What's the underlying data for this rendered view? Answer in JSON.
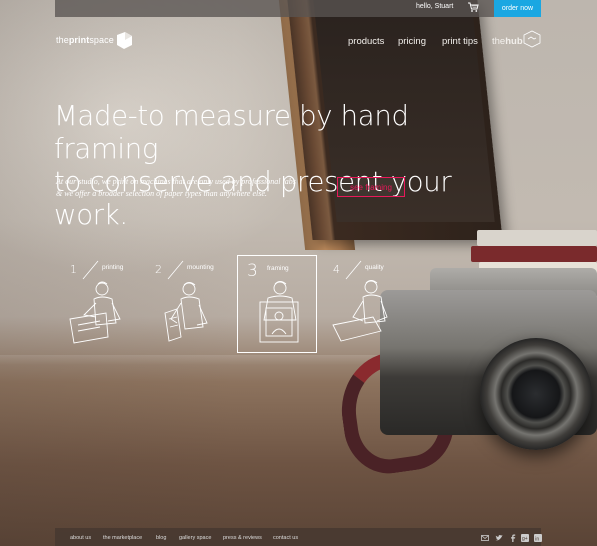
{
  "topbar": {
    "greeting": "hello, Stuart",
    "cart_icon": "shopping-cart-icon",
    "order_button": "order now",
    "order_color": "#1aa7e2"
  },
  "header": {
    "logo_prefix": "the",
    "logo_bold": "print",
    "logo_suffix": "space",
    "nav": [
      {
        "label": "products"
      },
      {
        "label": "pricing"
      },
      {
        "label": "print tips"
      }
    ],
    "hub_prefix": "the",
    "hub_bold": "hub"
  },
  "hero": {
    "headline_line1": "Made-to measure by hand framing",
    "headline_line2": "to conserve and present your work.",
    "sub_line1": "At our studio, we print on machines that are only used by professional labs",
    "sub_line2": "& we offer a broader selection of paper types than anywhere else.",
    "cta": "see framing",
    "cta_color": "#e8195a"
  },
  "steps": [
    {
      "num": "1",
      "label": "printing",
      "active": false
    },
    {
      "num": "2",
      "label": "mounting",
      "active": false
    },
    {
      "num": "3",
      "label": "framing",
      "active": true
    },
    {
      "num": "4",
      "label": "quality",
      "active": false
    }
  ],
  "footer": {
    "links": [
      "about us",
      "the marketplace",
      "blog",
      "gallery space",
      "press & reviews",
      "contact us"
    ],
    "social_icons": [
      "email-icon",
      "twitter-icon",
      "facebook-icon",
      "google-plus-icon",
      "linkedin-icon"
    ]
  }
}
